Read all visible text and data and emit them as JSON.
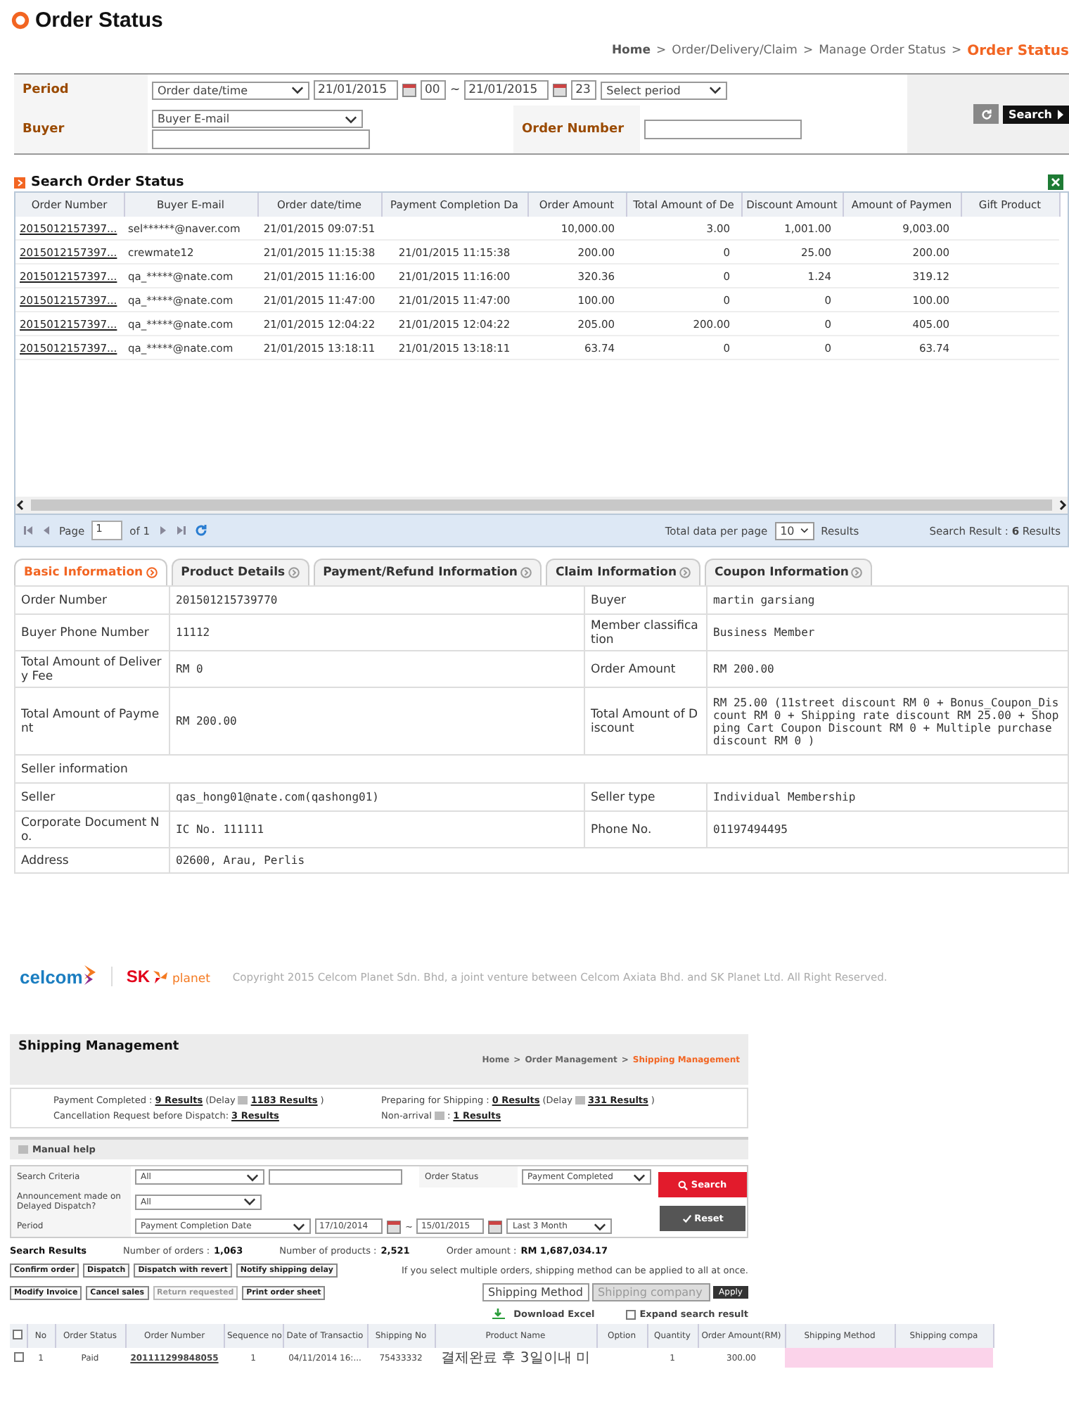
{
  "page_title": "Order Status",
  "breadcrumb": [
    "Home",
    ">",
    "Order/Delivery/Claim",
    ">",
    "Manage Order Status",
    ">",
    "Order Status"
  ],
  "search_form": {
    "period_label": "Period",
    "period_type": "Order date/time",
    "date_from": "21/01/2015",
    "hour_from": "00",
    "tilde": "~",
    "date_to": "21/01/2015",
    "hour_to": "23",
    "period_select": "Select period",
    "buyer_label": "Buyer",
    "buyer_type": "Buyer E-mail",
    "order_number_label": "Order Number",
    "search_button": "Search"
  },
  "results": {
    "title": "Search Order Status",
    "columns": [
      "Order Number",
      "Buyer E-mail",
      "Order date/time",
      "Payment Completion Da",
      "Order Amount",
      "Total Amount of De",
      "Discount Amount",
      "Amount of Paymen",
      "Gift Product"
    ],
    "rows": [
      [
        "2015012157397...",
        "sel******@naver.com",
        "21/01/2015 09:07:51",
        "",
        "10,000.00",
        "3.00",
        "1,001.00",
        "9,003.00",
        ""
      ],
      [
        "2015012157397...",
        "crewmate12",
        "21/01/2015 11:15:38",
        "21/01/2015 11:15:38",
        "200.00",
        "0",
        "25.00",
        "200.00",
        ""
      ],
      [
        "2015012157397...",
        "qa_*****@nate.com",
        "21/01/2015 11:16:00",
        "21/01/2015 11:16:00",
        "320.36",
        "0",
        "1.24",
        "319.12",
        ""
      ],
      [
        "2015012157397...",
        "qa_*****@nate.com",
        "21/01/2015 11:47:00",
        "21/01/2015 11:47:00",
        "100.00",
        "0",
        "0",
        "100.00",
        ""
      ],
      [
        "2015012157397...",
        "qa_*****@nate.com",
        "21/01/2015 12:04:22",
        "21/01/2015 12:04:22",
        "205.00",
        "200.00",
        "0",
        "405.00",
        ""
      ],
      [
        "2015012157397...",
        "qa_*****@nate.com",
        "21/01/2015 13:18:11",
        "21/01/2015 13:18:11",
        "63.74",
        "0",
        "0",
        "63.74",
        ""
      ]
    ]
  },
  "pager": {
    "page_label": "Page",
    "page": "1",
    "of": "of 1",
    "per_page_label": "Total data per page",
    "per_page": "10",
    "results_label": "Results",
    "summary": "Search Result : **6** Results"
  },
  "tabs": [
    {
      "label": "Basic Information",
      "selected": true
    },
    {
      "label": "Product Details",
      "selected": false
    },
    {
      "label": "Payment/Refund Information",
      "selected": false
    },
    {
      "label": "Claim Information",
      "selected": false
    },
    {
      "label": "Coupon Information",
      "selected": false
    }
  ],
  "details": [
    {
      "kind": "pair",
      "cells": [
        "Order Number",
        "201501215739770",
        "Buyer",
        "martin garsiang"
      ]
    },
    {
      "kind": "pair",
      "cells": [
        "Buyer Phone Number",
        "11112",
        "Member classification",
        "Business Member"
      ]
    },
    {
      "kind": "pair",
      "cells": [
        "Total Amount of Delivery Fee",
        "RM 0",
        "Order Amount",
        "RM 200.00"
      ]
    },
    {
      "kind": "pair",
      "cells": [
        "Total Amount of Payment",
        "RM 200.00",
        "Total Amount of Discount",
        "RM 25.00 (11street discount RM 0 + Bonus_Coupon_Discount  RM 0 + Shipping rate discount RM 25.00 + Shopping Cart Coupon Discount RM 0 + Multiple purchase discount RM 0 )"
      ]
    },
    {
      "kind": "section",
      "cells": [
        "Seller information"
      ]
    },
    {
      "kind": "pair",
      "cells": [
        "Seller",
        "qas_hong01@nate.com(qashong01)",
        "Seller type",
        "Individual Membership"
      ]
    },
    {
      "kind": "pair",
      "cells": [
        "Corporate Document No.",
        "IC No. 111111",
        "Phone No.",
        "01197494495"
      ]
    },
    {
      "kind": "single",
      "cells": [
        "Address",
        "02600, Arau, Perlis"
      ]
    }
  ],
  "footer": {
    "logo_1": "celcom",
    "logo_2a": "SK",
    "logo_2b": "planet",
    "copyright": "Copyright 2015 Celcom Planet Sdn. Bhd, a joint venture between Celcom Axiata Bhd. and SK Planet Ltd. All Right Reserved."
  },
  "shipping": {
    "title": "Shipping Management",
    "breadcrumb": [
      "Home",
      ">",
      "Order Management",
      ">",
      "Shipping Management"
    ],
    "stats": [
      {
        "kind": "delay",
        "label": "Payment Completed :",
        "value": "9 Results",
        "delay_label": "(Delay",
        "delay_value": "1183 Results",
        "close": ")"
      },
      {
        "kind": "delay",
        "label": "Preparing for Shipping :",
        "value": "0 Results",
        "delay_label": "(Delay",
        "delay_value": "331 Results",
        "close": ")"
      },
      {
        "kind": "plain",
        "label": "Cancellation Request before Dispatch:",
        "value": "3 Results"
      },
      {
        "kind": "icon",
        "label": "Non-arrival",
        "sep": ":",
        "value": "1 Results"
      }
    ],
    "help": "Manual help",
    "form": {
      "criteria_label": "Search Criteria",
      "criteria": "All",
      "status_label": "Order Status",
      "status": "Payment Completed",
      "delay_label": "Announcement made on Delayed Dispatch?",
      "delay": "All",
      "period_label": "Period",
      "period_type": "Payment Completion Date",
      "date_from": "17/10/2014",
      "tilde": "~",
      "date_to": "15/01/2015",
      "range": "Last 3 Month",
      "search": "Search",
      "reset": "Reset"
    },
    "summary": {
      "title": "Search Results",
      "items": [
        {
          "label": "Number of orders :",
          "value": "1,063"
        },
        {
          "label": "Number of products :",
          "value": "2,521"
        },
        {
          "label": "Order amount :",
          "value": "RM 1,687,034.17"
        }
      ]
    },
    "buttons_1": [
      {
        "label": "Confirm order",
        "disabled": false
      },
      {
        "label": "Dispatch",
        "disabled": false
      },
      {
        "label": "Dispatch with revert",
        "disabled": false
      },
      {
        "label": "Notify shipping delay",
        "disabled": false
      }
    ],
    "note": "If you select multiple orders, shipping method can be applied to all at once.",
    "buttons_2": [
      {
        "label": "Modify Invoice",
        "disabled": false
      },
      {
        "label": "Cancel sales",
        "disabled": false
      },
      {
        "label": "Return requested",
        "disabled": true
      },
      {
        "label": "Print order sheet",
        "disabled": false
      }
    ],
    "apply_selects": [
      {
        "label": "Shipping Method",
        "disabled": false
      },
      {
        "label": "Shipping company",
        "disabled": true
      }
    ],
    "apply": "Apply",
    "download": "Download Excel",
    "expand": {
      "label": "Expand search result",
      "checked": false
    },
    "columns": [
      "No",
      "Order Status",
      "Order Number",
      "Sequence no",
      "Date of Transactio",
      "Shipping No",
      "Product Name",
      "Option",
      "Quantity",
      "Order Amount(RM)",
      "Shipping Method",
      "Shipping compa"
    ],
    "header_checked": false,
    "rows": [
      {
        "checked": false,
        "cells": [
          "1",
          "Paid",
          "201111299848055",
          "1",
          "04/11/2014 16:...",
          "75433332",
          "결제완료 후 3일이내 미",
          "",
          "1",
          "300.00",
          "",
          ""
        ]
      }
    ]
  }
}
